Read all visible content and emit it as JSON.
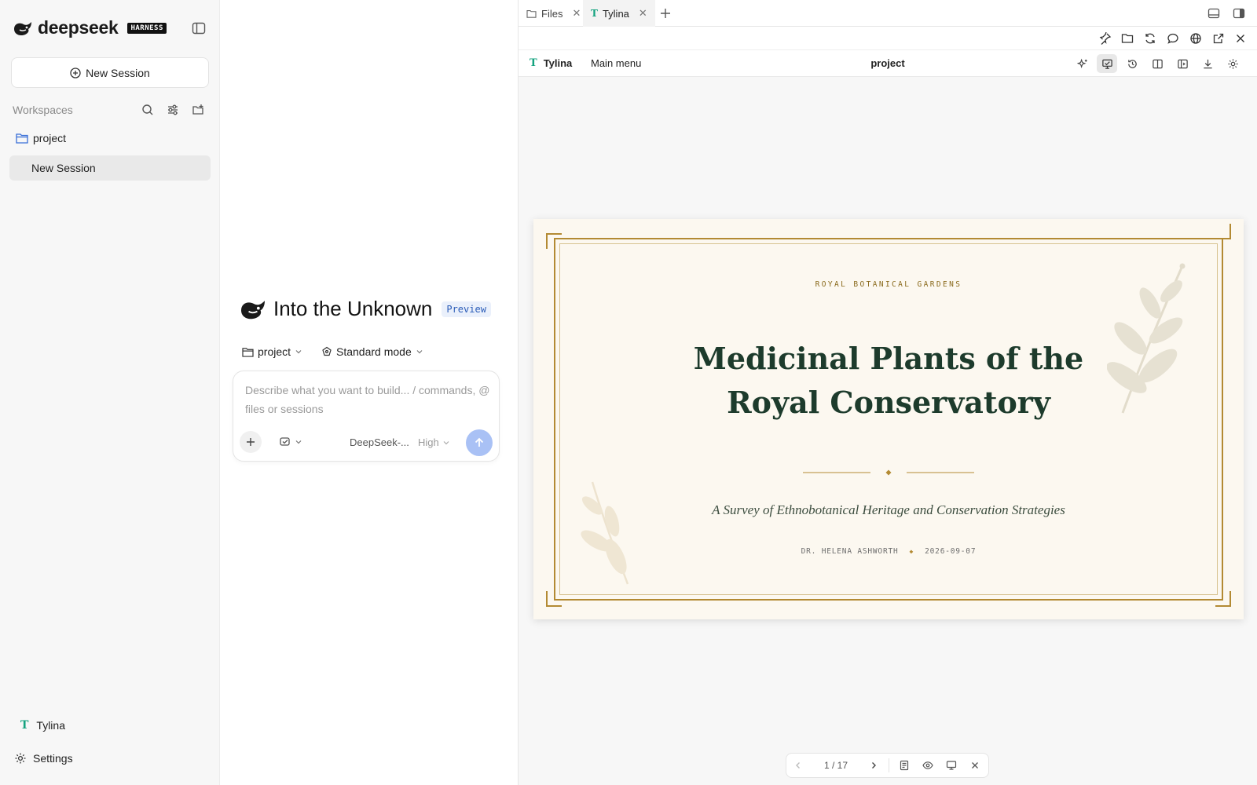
{
  "sidebar": {
    "brand": "deepseek",
    "brand_badge": "HARNESS",
    "new_session_label": "New Session",
    "workspaces_label": "Workspaces",
    "project_name": "project",
    "session_item": "New Session",
    "user_name": "Tylina",
    "user_initial": "T",
    "settings_label": "Settings"
  },
  "chat": {
    "title": "Into the Unknown",
    "badge": "Preview",
    "project_chip": "project",
    "mode_chip": "Standard mode",
    "composer_placeholder": "Describe what you want to build... / commands, @ files or sessions",
    "model": "DeepSeek-...",
    "effort": "High"
  },
  "tabs": [
    {
      "label": "Files"
    },
    {
      "label": "Tylina",
      "initial": "T"
    }
  ],
  "doc_header": {
    "app_initial": "T",
    "app_name": "Tylina",
    "menu_label": "Main menu",
    "project": "project"
  },
  "slide": {
    "kicker": "ROYAL BOTANICAL GARDENS",
    "title": "Medicinal Plants of the Royal Conservatory",
    "subtitle": "A Survey of Ethnobotanical Heritage and Conservation Strategies",
    "author": "DR. HELENA ASHWORTH",
    "date": "2026-09-07"
  },
  "pager": {
    "current": "1",
    "total": "17",
    "display": "1 / 17"
  },
  "colors": {
    "accent_blue": "#a9c1f5",
    "slide_bg": "#fcf8f0",
    "slide_gold": "#b38a33",
    "slide_title": "#1d3b2c",
    "brand_teal": "#14a37f"
  },
  "icons": [
    "whale-logo-icon",
    "sidebar-toggle-icon",
    "plus-circle-icon",
    "search-icon",
    "sliders-icon",
    "folder-plus-icon",
    "folder-icon",
    "gear-icon",
    "mode-icon",
    "plus-icon",
    "tool-icon",
    "arrow-up-icon",
    "close-icon",
    "layout-icon",
    "pin-icon",
    "refresh-icon",
    "chat-icon",
    "globe-icon",
    "external-icon",
    "sparkle-icon",
    "present-icon",
    "history-icon",
    "columns-icon",
    "panel-icon",
    "download-icon",
    "chevron-left-icon",
    "chevron-right-icon",
    "notes-icon",
    "eye-icon"
  ]
}
